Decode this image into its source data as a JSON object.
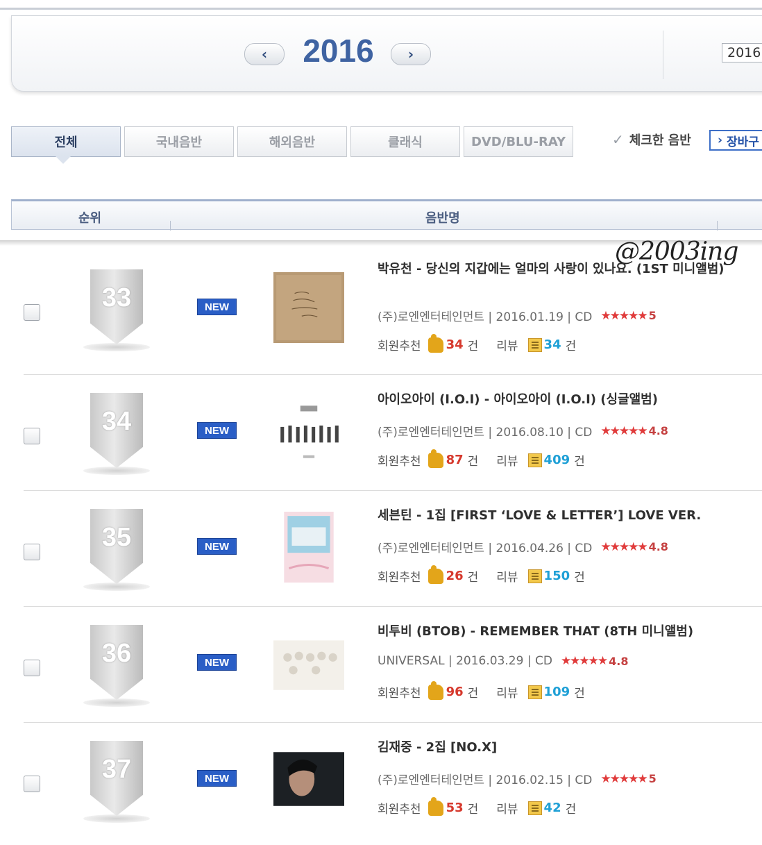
{
  "year_nav": {
    "year": "2016",
    "prev_glyph": "‹",
    "next_glyph": "›",
    "year_select_value": "2016"
  },
  "tabs": [
    {
      "label": "전체",
      "active": true
    },
    {
      "label": "국내음반",
      "active": false
    },
    {
      "label": "해외음반",
      "active": false
    },
    {
      "label": "클래식",
      "active": false
    },
    {
      "label": "DVD/BLU-RAY",
      "active": false
    }
  ],
  "toolbar": {
    "checked_label": "체크한 음반",
    "cart_label": "장바구"
  },
  "columns": {
    "rank": "순위",
    "album": "음반명"
  },
  "watermark": "@2003ing",
  "labels": {
    "recommend": "회원추천",
    "review": "리뷰",
    "unit": "건",
    "new": "NEW"
  },
  "albums": [
    {
      "rank": "33",
      "title": "박유천 - 당신의 지갑에는 얼마의 사랑이 있나요. (1ST 미니앨범)",
      "info": "(주)로엔엔터테인먼트 | 2016.01.19 | CD",
      "stars": "★★★★★",
      "rating": "5",
      "recommend": "34",
      "review": "34"
    },
    {
      "rank": "34",
      "title": "아이오아이 (I.O.I) - 아이오아이 (I.O.I) (싱글앨범)",
      "info": "(주)로엔엔터테인먼트 | 2016.08.10 | CD",
      "stars": "★★★★★",
      "rating": "4.8",
      "recommend": "87",
      "review": "409"
    },
    {
      "rank": "35",
      "title": "세븐틴 - 1집 [FIRST ‘LOVE & LETTER’] LOVE VER.",
      "info": "(주)로엔엔터테인먼트 | 2016.04.26 | CD",
      "stars": "★★★★★",
      "rating": "4.8",
      "recommend": "26",
      "review": "150"
    },
    {
      "rank": "36",
      "title": "비투비 (BTOB) - REMEMBER THAT (8TH 미니앨범)",
      "info": "UNIVERSAL | 2016.03.29 | CD",
      "stars": "★★★★★",
      "rating": "4.8",
      "recommend": "96",
      "review": "109"
    },
    {
      "rank": "37",
      "title": "김재중 - 2집 [NO.X]",
      "info": "(주)로엔엔터테인먼트 | 2016.02.15 | CD",
      "stars": "★★★★★",
      "rating": "5",
      "recommend": "53",
      "review": "42"
    }
  ]
}
